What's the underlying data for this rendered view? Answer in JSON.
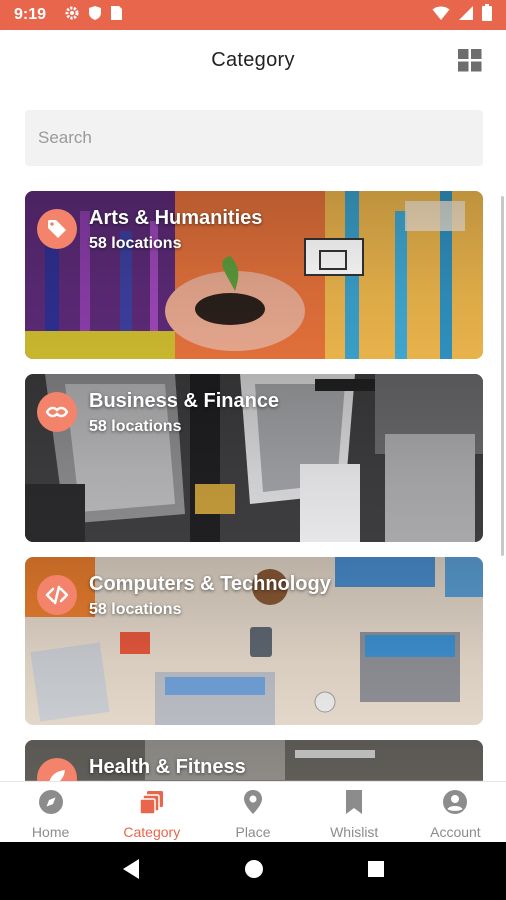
{
  "status_bar": {
    "time": "9:19",
    "bg_color": "#e8664b",
    "left_icons": [
      "settings-icon",
      "shield-icon",
      "sim-card-icon"
    ],
    "right_icons": [
      "wifi-icon",
      "cell-signal-icon",
      "battery-icon"
    ]
  },
  "header": {
    "title": "Category",
    "grid_icon": "grid-view-icon"
  },
  "search": {
    "placeholder": "Search",
    "value": ""
  },
  "categories": [
    {
      "title": "Arts & Humanities",
      "count": "58 locations",
      "icon": "tag-icon"
    },
    {
      "title": "Business & Finance",
      "count": "58 locations",
      "icon": "handshake-icon"
    },
    {
      "title": "Computers & Technology",
      "count": "58 locations",
      "icon": "code-icon"
    },
    {
      "title": "Health & Fitness",
      "count": "",
      "icon": "fitness-icon"
    }
  ],
  "bottom_nav": [
    {
      "label": "Home",
      "icon": "compass-icon",
      "active": false
    },
    {
      "label": "Category",
      "icon": "category-icon",
      "active": true
    },
    {
      "label": "Place",
      "icon": "place-icon",
      "active": false
    },
    {
      "label": "Whislist",
      "icon": "bookmark-icon",
      "active": false
    },
    {
      "label": "Account",
      "icon": "account-icon",
      "active": false
    }
  ],
  "colors": {
    "accent": "#e8664b",
    "icon_circle": "#f3836a",
    "nav_inactive": "#8c8c8c"
  }
}
